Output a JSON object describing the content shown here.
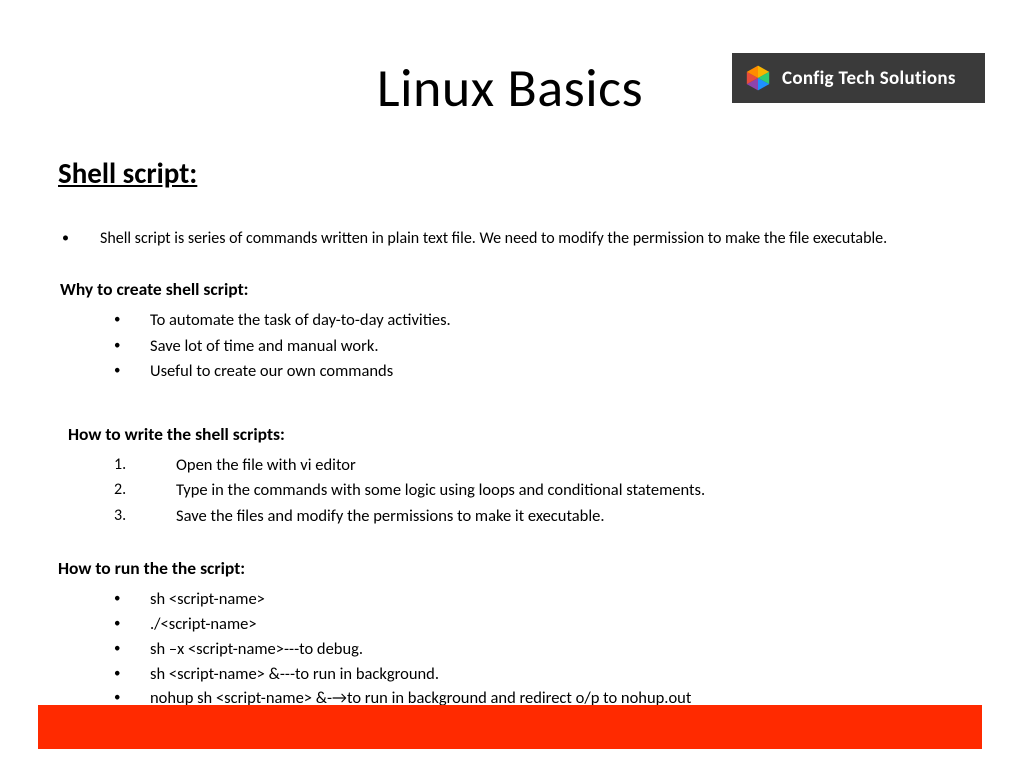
{
  "title": "Linux Basics",
  "logo": {
    "text": "Config Tech Solutions"
  },
  "section_heading": "Shell script:",
  "intro": "Shell script is series of commands written in plain text file. We need to modify the permission to make the file executable.",
  "why": {
    "heading": "Why to create shell script:",
    "items": [
      "To automate the task of day-to-day activities.",
      "Save lot of time and manual work.",
      "Useful to create our own commands"
    ]
  },
  "how_write": {
    "heading": "How to write the shell scripts:",
    "items": [
      "Open the file with vi editor",
      "Type in the commands with some logic using loops and conditional statements.",
      "Save the files and modify the permissions to make it executable."
    ]
  },
  "how_run": {
    "heading": "How to run the the script:",
    "items": [
      "sh <script-name>",
      "./<script-name>",
      "sh –x <script-name>---to debug.",
      "sh <script-name> &---to run in background.",
      "nohup sh <script-name> &-→to run in background and redirect o/p to nohup.out"
    ]
  }
}
